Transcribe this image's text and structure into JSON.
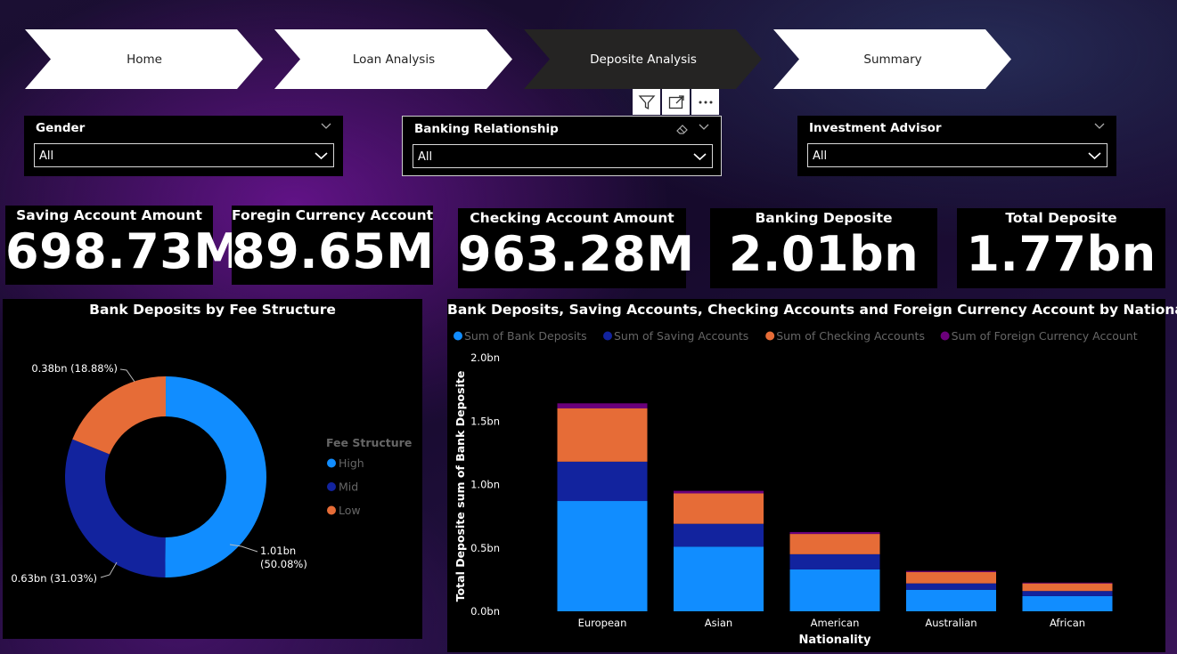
{
  "nav": {
    "items": [
      {
        "label": "Home",
        "active": false
      },
      {
        "label": "Loan Analysis",
        "active": false
      },
      {
        "label": "Deposite Analysis",
        "active": true
      },
      {
        "label": "Summary",
        "active": false
      }
    ]
  },
  "visual_header": {
    "icons": [
      "filter-icon",
      "focus-mode-icon",
      "more-options-icon"
    ]
  },
  "slicers": {
    "gender": {
      "title": "Gender",
      "value": "All"
    },
    "banking_relationship": {
      "title": "Banking Relationship",
      "value": "All"
    },
    "investment_advisor": {
      "title": "Investment Advisor",
      "value": "All"
    }
  },
  "kpis": {
    "saving": {
      "title": "Saving Account Amount",
      "value": "698.73M"
    },
    "foreign": {
      "title": "Foregin Currency Account",
      "value": "89.65M"
    },
    "checking": {
      "title": "Checking Account Amount",
      "value": "963.28M"
    },
    "banking": {
      "title": "Banking Deposite",
      "value": "2.01bn"
    },
    "total": {
      "title": "Total Deposite",
      "value": "1.77bn"
    }
  },
  "colors": {
    "high": "#118DFF",
    "mid": "#12239E",
    "low": "#E66C37",
    "foreign": "#6B007B",
    "nav_active": "#252423"
  },
  "chart_data": [
    {
      "type": "pie",
      "title": "Bank Deposits by Fee Structure",
      "legend_title": "Fee Structure",
      "legend_position": "right",
      "donut": true,
      "slices": [
        {
          "name": "High",
          "value": 1.01,
          "unit": "bn",
          "percent": 50.08,
          "label": "1.01bn\n(50.08%)",
          "color": "#118DFF"
        },
        {
          "name": "Mid",
          "value": 0.63,
          "unit": "bn",
          "percent": 31.03,
          "label": "0.63bn (31.03%)",
          "color": "#12239E"
        },
        {
          "name": "Low",
          "value": 0.38,
          "unit": "bn",
          "percent": 18.88,
          "label": "0.38bn (18.88%)",
          "color": "#E66C37"
        }
      ]
    },
    {
      "type": "bar",
      "stacked": true,
      "title": "Bank Deposits, Saving Accounts, Checking Accounts and Foreign Currency Account by Nationality",
      "xlabel": "Nationality",
      "ylabel": "Total Deposite sum of Bank Deposite",
      "ylim": [
        0,
        2.0
      ],
      "yticks": [
        "0.0bn",
        "0.5bn",
        "1.0bn",
        "1.5bn",
        "2.0bn"
      ],
      "legend_position": "top-left",
      "categories": [
        "European",
        "Asian",
        "American",
        "Australian",
        "African"
      ],
      "series": [
        {
          "name": "Sum of Bank Deposits",
          "color": "#118DFF",
          "values": [
            0.87,
            0.51,
            0.33,
            0.17,
            0.12
          ]
        },
        {
          "name": "Sum of Saving Accounts",
          "color": "#12239E",
          "values": [
            0.31,
            0.18,
            0.12,
            0.05,
            0.04
          ]
        },
        {
          "name": "Sum of Checking Accounts",
          "color": "#E66C37",
          "values": [
            0.42,
            0.24,
            0.16,
            0.09,
            0.06
          ]
        },
        {
          "name": "Sum of Foreign Currency Account",
          "color": "#6B007B",
          "values": [
            0.04,
            0.02,
            0.015,
            0.008,
            0.006
          ]
        }
      ]
    }
  ]
}
